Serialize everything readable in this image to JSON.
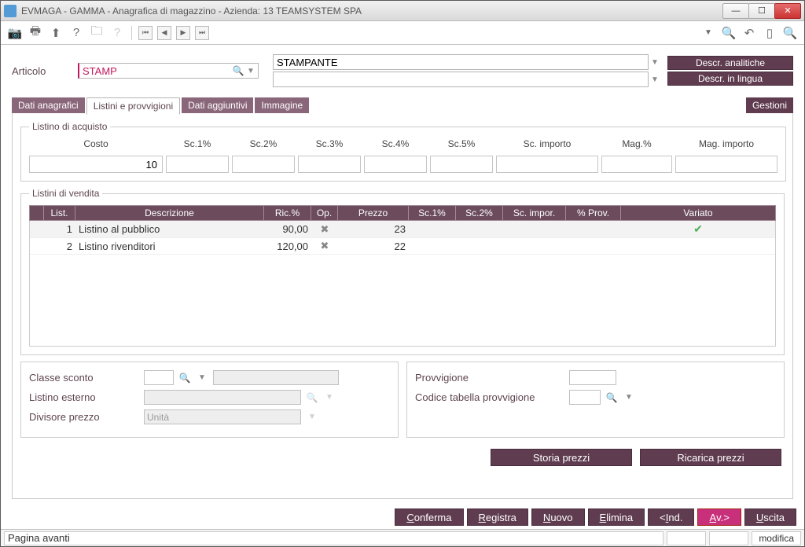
{
  "window": {
    "title": "EVMAGA - GAMMA - Anagrafica di magazzino - Azienda:   13 TEAMSYSTEM SPA"
  },
  "header": {
    "articolo_label": "Articolo",
    "articolo_value": "STAMP",
    "descr_value": "STAMPANTE",
    "btn_analitiche": "Descr. analitiche",
    "btn_lingua": "Descr. in lingua"
  },
  "tabs": {
    "dati_anagrafici": "Dati anagrafici",
    "listini": "Listini e provvigioni",
    "dati_aggiuntivi": "Dati aggiuntivi",
    "immagine": "Immagine",
    "gestioni": "Gestioni"
  },
  "acquisto": {
    "legend": "Listino di acquisto",
    "cols": {
      "costo": "Costo",
      "sc1": "Sc.1%",
      "sc2": "Sc.2%",
      "sc3": "Sc.3%",
      "sc4": "Sc.4%",
      "sc5": "Sc.5%",
      "scimp": "Sc. importo",
      "magp": "Mag.%",
      "magimp": "Mag. importo"
    },
    "costo_value": "10"
  },
  "vendita": {
    "legend": "Listini di vendita",
    "cols": {
      "list": "List.",
      "descr": "Descrizione",
      "ric": "Ric.%",
      "op": "Op.",
      "prezzo": "Prezzo",
      "sc1": "Sc.1%",
      "sc2": "Sc.2%",
      "scimp": "Sc. impor.",
      "prov": "% Prov.",
      "variato": "Variato"
    },
    "rows": [
      {
        "n": "1",
        "descr": "Listino al pubblico",
        "ric": "90,00",
        "prezzo": "23",
        "variato": true
      },
      {
        "n": "2",
        "descr": "Listino rivenditori",
        "ric": "120,00",
        "prezzo": "22",
        "variato": false
      }
    ]
  },
  "lower_left": {
    "classe_sconto": "Classe sconto",
    "listino_esterno": "Listino esterno",
    "divisore_prezzo": "Divisore prezzo",
    "divisore_value": "Unità"
  },
  "lower_right": {
    "provvigione": "Provvigione",
    "codice_tab": "Codice tabella provvigione"
  },
  "actions": {
    "storia": "Storia prezzi",
    "ricarica": "Ricarica prezzi"
  },
  "footer": {
    "conferma": "Conferma",
    "registra": "Registra",
    "nuovo": "Nuovo",
    "elimina": "Elimina",
    "ind": "<Ind.",
    "av": "Av.>",
    "uscita": "Uscita"
  },
  "status": {
    "text": "Pagina avanti",
    "mode": "modifica"
  }
}
